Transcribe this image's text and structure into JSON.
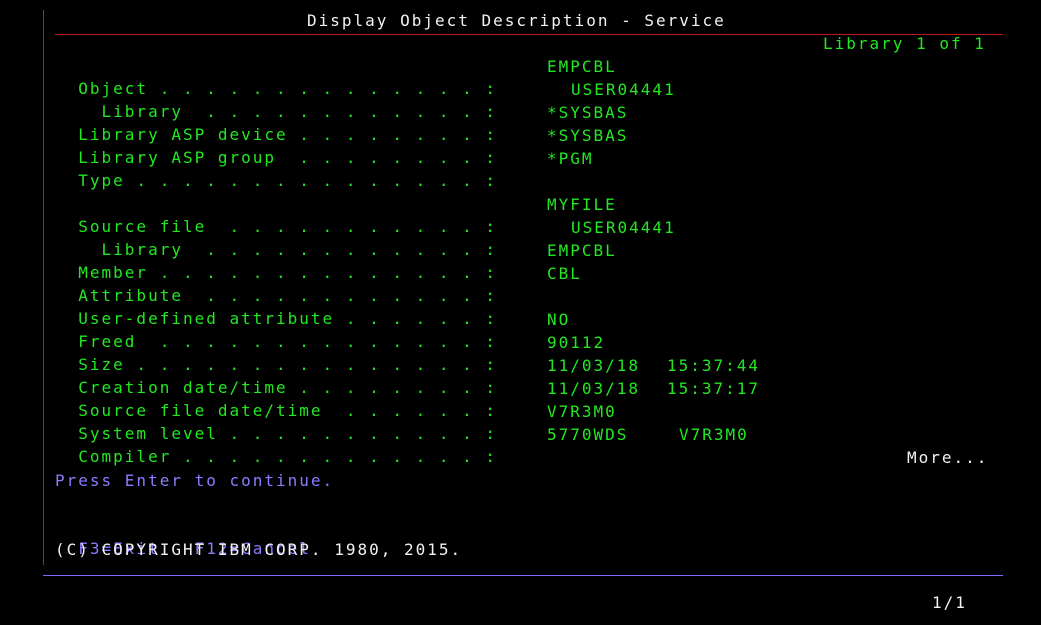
{
  "screen": {
    "title": "Display Object Description - Service",
    "library_counter": "Library 1 of 1",
    "more_indicator": "More...",
    "page_indicator": "1/1"
  },
  "fields": [
    {
      "label": "Object . . . . . . . . . . . . . . :",
      "value": "EMPCBL"
    },
    {
      "label": "  Library  . . . . . . . . . . . . :",
      "value": "USER04441"
    },
    {
      "label": "Library ASP device . . . . . . . . :",
      "value": "*SYSBAS"
    },
    {
      "label": "Library ASP group  . . . . . . . . :",
      "value": "*SYSBAS"
    },
    {
      "label": "Type . . . . . . . . . . . . . . . :",
      "value": "*PGM"
    },
    {
      "label": "Source file  . . . . . . . . . . . :",
      "value": "MYFILE"
    },
    {
      "label": "  Library  . . . . . . . . . . . . :",
      "value": "USER04441"
    },
    {
      "label": "Member . . . . . . . . . . . . . . :",
      "value": "EMPCBL"
    },
    {
      "label": "Attribute  . . . . . . . . . . . . :",
      "value": "CBL"
    },
    {
      "label": "User-defined attribute . . . . . . :",
      "value": ""
    },
    {
      "label": "Freed  . . . . . . . . . . . . . . :",
      "value": "NO"
    },
    {
      "label": "Size . . . . . . . . . . . . . . . :",
      "value": "90112"
    },
    {
      "label": "Creation date/time . . . . . . . . :",
      "value": "11/03/18",
      "value2": "15:37:44"
    },
    {
      "label": "Source file date/time  . . . . . . :",
      "value": "11/03/18",
      "value2": "15:37:17"
    },
    {
      "label": "System level . . . . . . . . . . . :",
      "value": "V7R3M0"
    },
    {
      "label": "Compiler . . . . . . . . . . . . . :",
      "value": "5770WDS",
      "value3": "V7R3M0"
    }
  ],
  "prompt": "Press Enter to continue.",
  "function_keys": {
    "exit": "F3=Exit",
    "cancel": "F12=Cancel"
  },
  "copyright": "(C) COPYRIGHT IBM CORP. 1980, 2015.",
  "colors": {
    "field_text": "#22e822",
    "normal_text": "#f2f2f2",
    "prompt_text": "#8a7cff",
    "separator_red": "#c01818",
    "separator_blue": "#7a6cff",
    "background": "#000000"
  }
}
